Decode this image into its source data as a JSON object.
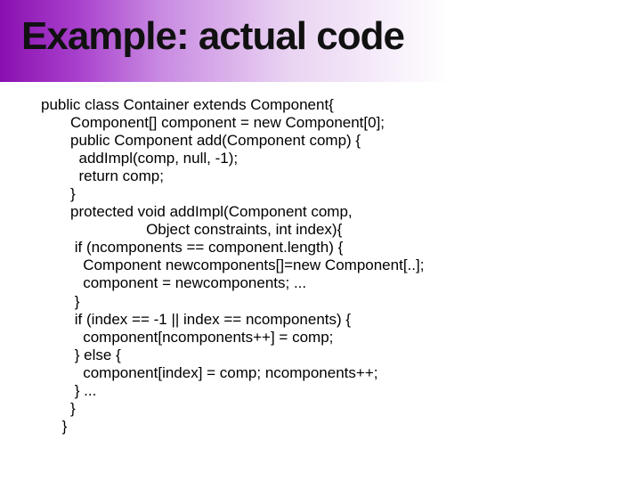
{
  "title": "Example: actual code",
  "code": "public class Container extends Component{\n       Component[] component = new Component[0];\n       public Component add(Component comp) {\n         addImpl(comp, null, -1);\n         return comp;\n       }\n       protected void addImpl(Component comp,\n                         Object constraints, int index){\n        if (ncomponents == component.length) {\n          Component newcomponents[]=new Component[..];\n          component = newcomponents; ...\n        }\n        if (index == -1 || index == ncomponents) {\n          component[ncomponents++] = comp;\n        } else {\n          component[index] = comp; ncomponents++;\n        } ...\n       }\n     }"
}
